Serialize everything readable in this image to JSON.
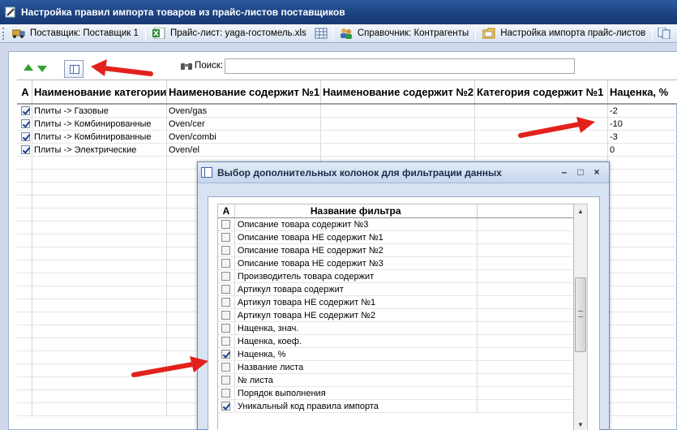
{
  "window": {
    "title": "Настройка правил импорта товаров из прайс-листов поставщиков"
  },
  "toolbar": {
    "supplier": "Поставщик: Поставщик 1",
    "pricelist": "Прайс-лист: yaga-гостомель.xls",
    "directory": "Справочник: Контрагенты",
    "import_settings": "Настройка импорта прайс-листов"
  },
  "search": {
    "label": "Поиск:",
    "value": ""
  },
  "grid": {
    "columns": [
      "A",
      "Наименование категории",
      "Наименование содержит №1",
      "Наименование содержит №2",
      "Категория содержит №1",
      "Наценка, %"
    ],
    "rows": [
      {
        "checked": true,
        "category": "Плиты -> Газовые",
        "name1": "Oven/gas",
        "name2": "",
        "cat1": "",
        "markup": "-2"
      },
      {
        "checked": true,
        "category": "Плиты -> Комбинированные",
        "name1": "Oven/cer",
        "name2": "",
        "cat1": "",
        "markup": "-10"
      },
      {
        "checked": true,
        "category": "Плиты -> Комбинированные",
        "name1": "Oven/combi",
        "name2": "",
        "cat1": "",
        "markup": "-3"
      },
      {
        "checked": true,
        "category": "Плиты -> Электрические",
        "name1": "Oven/el",
        "name2": "",
        "cat1": "",
        "markup": "0"
      }
    ]
  },
  "dialog": {
    "title": "Выбор дополнительных колонок для фильтрации данных",
    "buttons": {
      "minimize": "–",
      "maximize": "□",
      "close": "×"
    },
    "columns": [
      "A",
      "Название фильтра"
    ],
    "rows": [
      {
        "checked": false,
        "label": "Описание товара содержит №3"
      },
      {
        "checked": false,
        "label": "Описание товара НЕ содержит №1"
      },
      {
        "checked": false,
        "label": "Описание товара НЕ содержит №2"
      },
      {
        "checked": false,
        "label": "Описание товара НЕ содержит №3"
      },
      {
        "checked": false,
        "label": "Производитель товара содержит"
      },
      {
        "checked": false,
        "label": "Артикул товара содержит"
      },
      {
        "checked": false,
        "label": "Артикул товара НЕ содержит №1"
      },
      {
        "checked": false,
        "label": "Артикул товара НЕ содержит №2"
      },
      {
        "checked": false,
        "label": "Наценка, знач."
      },
      {
        "checked": false,
        "label": "Наценка, коеф."
      },
      {
        "checked": true,
        "label": "Наценка, %"
      },
      {
        "checked": false,
        "label": "Название листа"
      },
      {
        "checked": false,
        "label": "№ листа"
      },
      {
        "checked": false,
        "label": "Порядок выполнения"
      },
      {
        "checked": true,
        "label": "Уникальный код правила импорта"
      }
    ]
  },
  "colors": {
    "titlebar": "#1b4180",
    "accent_arrow": "#e3211c",
    "move_arrows": "#2ea12e"
  }
}
